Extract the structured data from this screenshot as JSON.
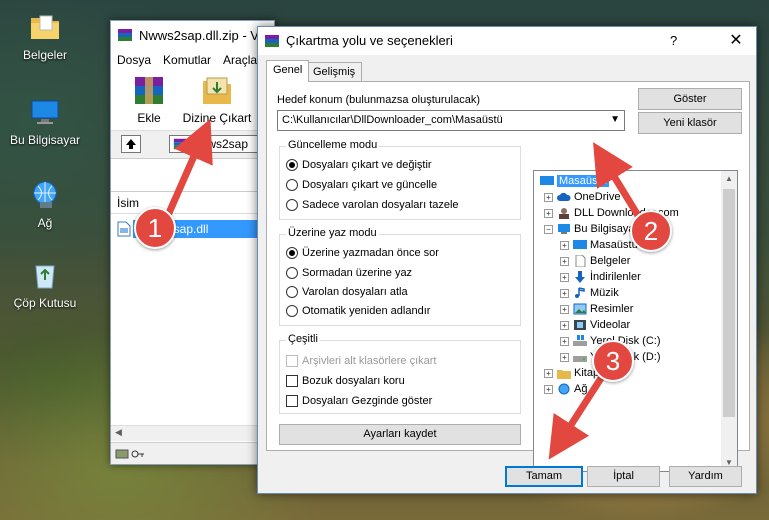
{
  "desktop": {
    "icons": [
      {
        "label": "Belgeler"
      },
      {
        "label": "Bu Bilgisayar"
      },
      {
        "label": "Ağ"
      },
      {
        "label": "Çöp Kutusu"
      }
    ]
  },
  "winrar": {
    "title": "Nwws2sap.dll.zip - V",
    "menu": [
      "Dosya",
      "Komutlar",
      "Araçla"
    ],
    "toolbar": {
      "add_label": "Ekle",
      "extract_label": "Dizine Çıkart"
    },
    "address": "Nwws2sap",
    "column_name": "İsim",
    "file": "nwws2sap.dll"
  },
  "dialog": {
    "title": "Çıkartma yolu ve seçenekleri",
    "help_glyph": "?",
    "close_glyph": "✕",
    "tabs": [
      "Genel",
      "Gelişmiş"
    ],
    "dest_label": "Hedef konum (bulunmazsa oluşturulacak)",
    "dest_value": "C:\\Kullanıcılar\\DllDownloader_com\\Masaüstü",
    "show_button": "Göster",
    "new_folder_button": "Yeni klasör",
    "update_mode": {
      "title": "Güncelleme modu",
      "options": [
        "Dosyaları çıkart ve değiştir",
        "Dosyaları çıkart ve güncelle",
        "Sadece varolan dosyaları tazele"
      ],
      "selected": 0
    },
    "overwrite_mode": {
      "title": "Üzerine yaz modu",
      "options": [
        "Üzerine yazmadan önce sor",
        "Sormadan üzerine yaz",
        "Varolan dosyaları atla",
        "Otomatik yeniden adlandır"
      ],
      "selected": 0
    },
    "misc": {
      "title": "Çeşitli",
      "options": [
        "Arşivleri alt klasörlere çıkart",
        "Bozuk dosyaları koru",
        "Dosyaları Gezginde göster"
      ]
    },
    "save_settings_button": "Ayarları kaydet",
    "tree": [
      {
        "label": "Masaüstü",
        "selected": true
      },
      {
        "label": "OneDrive"
      },
      {
        "label": "DLL Downloader.com"
      },
      {
        "label": "Bu Bilgisayar"
      },
      {
        "label": "Masaüstü"
      },
      {
        "label": "Belgeler"
      },
      {
        "label": "İndirilenler"
      },
      {
        "label": "Müzik"
      },
      {
        "label": "Resimler"
      },
      {
        "label": "Videolar"
      },
      {
        "label": "Yerel Disk (C:)"
      },
      {
        "label": "Yerel Disk (D:)"
      },
      {
        "label": "Kitaplıklar"
      },
      {
        "label": "Ağ"
      }
    ],
    "ok_button": "Tamam",
    "cancel_button": "İptal",
    "help_button": "Yardım"
  },
  "annotations": {
    "steps": [
      "1",
      "2",
      "3"
    ],
    "color": "#e2483f"
  }
}
